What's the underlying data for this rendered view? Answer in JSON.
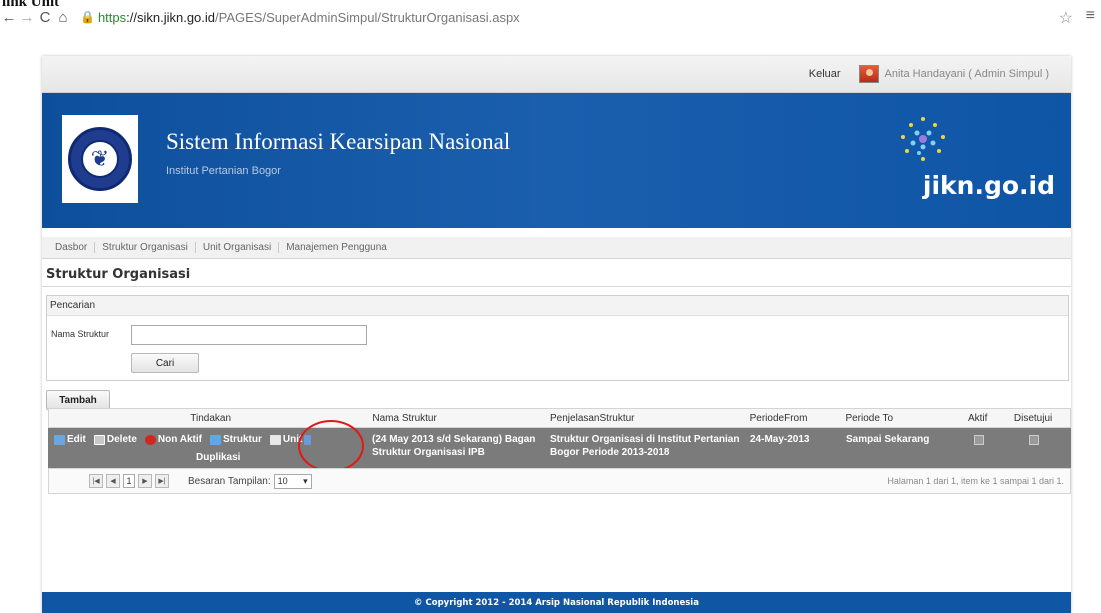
{
  "caption": "link Unit",
  "browser": {
    "url_scheme": "https",
    "url_host": "://sikn.jikn.go.id",
    "url_path": "/PAGES/SuperAdminSimpul/StrukturOrganisasi.aspx"
  },
  "userbar": {
    "logout": "Keluar",
    "user": "Anita Handayani ( Admin Simpul )"
  },
  "banner": {
    "title": "Sistem Informasi Kearsipan Nasional",
    "subtitle": "Institut Pertanian Bogor",
    "brand": "jikn.go.id"
  },
  "nav": [
    "Dasbor",
    "Struktur Organisasi",
    "Unit Organisasi",
    "Manajemen Pengguna"
  ],
  "page": {
    "title": "Struktur Organisasi"
  },
  "search": {
    "header": "Pencarian",
    "label": "Nama Struktur",
    "value": "",
    "button": "Cari"
  },
  "add_button": "Tambah",
  "grid": {
    "headers": {
      "actions": "Tindakan",
      "nama": "Nama Struktur",
      "penjelasan": "PenjelasanStruktur",
      "from": "PeriodeFrom",
      "to": "Periode To",
      "aktif": "Aktif",
      "disetujui": "Disetujui"
    },
    "row": {
      "edit": "Edit",
      "delete": "Delete",
      "nonaktif": "Non Aktif",
      "struktur": "Struktur",
      "unit": "Unit",
      "duplikasi": "Duplikasi",
      "nama": "(24 May 2013 s/d Sekarang) Bagan Struktur Organisasi IPB",
      "penjelasan": "Struktur Organisasi di Institut Pertanian Bogor Periode 2013-2018",
      "from": "24-May-2013",
      "to": "Sampai Sekarang"
    },
    "pager": {
      "current": "1",
      "size_label": "Besaran Tampilan:",
      "size": "10",
      "info": "Halaman 1 dari 1, item ke 1 sampai 1 dari 1."
    }
  },
  "footer": "© Copyright 2012 - 2014 Arsip Nasional Republik Indonesia"
}
